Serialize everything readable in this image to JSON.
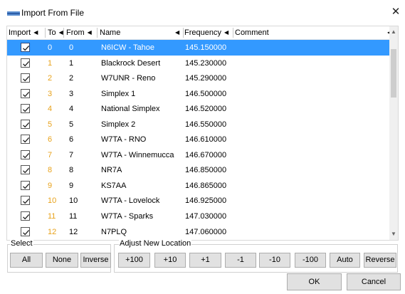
{
  "window": {
    "title": "Import From File"
  },
  "grid": {
    "columns": [
      "Import",
      "To",
      "From",
      "Name",
      "Frequency",
      "Comment"
    ],
    "rows": [
      {
        "to": "0",
        "from": "0",
        "name": "N6ICW - Tahoe",
        "frequency": "145.150000",
        "comment": "",
        "checked": true,
        "selected": true
      },
      {
        "to": "1",
        "from": "1",
        "name": "Blackrock Desert",
        "frequency": "145.230000",
        "comment": "",
        "checked": true,
        "selected": false
      },
      {
        "to": "2",
        "from": "2",
        "name": "W7UNR - Reno",
        "frequency": "145.290000",
        "comment": "",
        "checked": true,
        "selected": false
      },
      {
        "to": "3",
        "from": "3",
        "name": "Simplex 1",
        "frequency": "146.500000",
        "comment": "",
        "checked": true,
        "selected": false
      },
      {
        "to": "4",
        "from": "4",
        "name": "National Simplex",
        "frequency": "146.520000",
        "comment": "",
        "checked": true,
        "selected": false
      },
      {
        "to": "5",
        "from": "5",
        "name": "Simplex 2",
        "frequency": "146.550000",
        "comment": "",
        "checked": true,
        "selected": false
      },
      {
        "to": "6",
        "from": "6",
        "name": "W7TA - RNO",
        "frequency": "146.610000",
        "comment": "",
        "checked": true,
        "selected": false
      },
      {
        "to": "7",
        "from": "7",
        "name": "W7TA - Winnemucca",
        "frequency": "146.670000",
        "comment": "",
        "checked": true,
        "selected": false
      },
      {
        "to": "8",
        "from": "8",
        "name": "NR7A",
        "frequency": "146.850000",
        "comment": "",
        "checked": true,
        "selected": false
      },
      {
        "to": "9",
        "from": "9",
        "name": "KS7AA",
        "frequency": "146.865000",
        "comment": "",
        "checked": true,
        "selected": false
      },
      {
        "to": "10",
        "from": "10",
        "name": "W7TA - Lovelock",
        "frequency": "146.925000",
        "comment": "",
        "checked": true,
        "selected": false
      },
      {
        "to": "11",
        "from": "11",
        "name": "W7TA - Sparks",
        "frequency": "147.030000",
        "comment": "",
        "checked": true,
        "selected": false
      },
      {
        "to": "12",
        "from": "12",
        "name": "N7PLQ",
        "frequency": "147.060000",
        "comment": "",
        "checked": true,
        "selected": false
      }
    ]
  },
  "select_group": {
    "label": "Select",
    "buttons": [
      "All",
      "None",
      "Inverse"
    ]
  },
  "adjust_group": {
    "label": "Adjust New Location",
    "buttons": [
      "+100",
      "+10",
      "+1",
      "-1",
      "-10",
      "-100",
      "Auto",
      "Reverse"
    ]
  },
  "footer": {
    "ok_label": "OK",
    "cancel_label": "Cancel"
  },
  "icons": {
    "close": "close-icon",
    "sort": "sort-arrow-icon",
    "check": "checkmark-icon",
    "app": "app-icon"
  },
  "colors": {
    "selection": "#3399ff",
    "to_column": "#e8a21a",
    "button_face": "#e1e1e1"
  }
}
